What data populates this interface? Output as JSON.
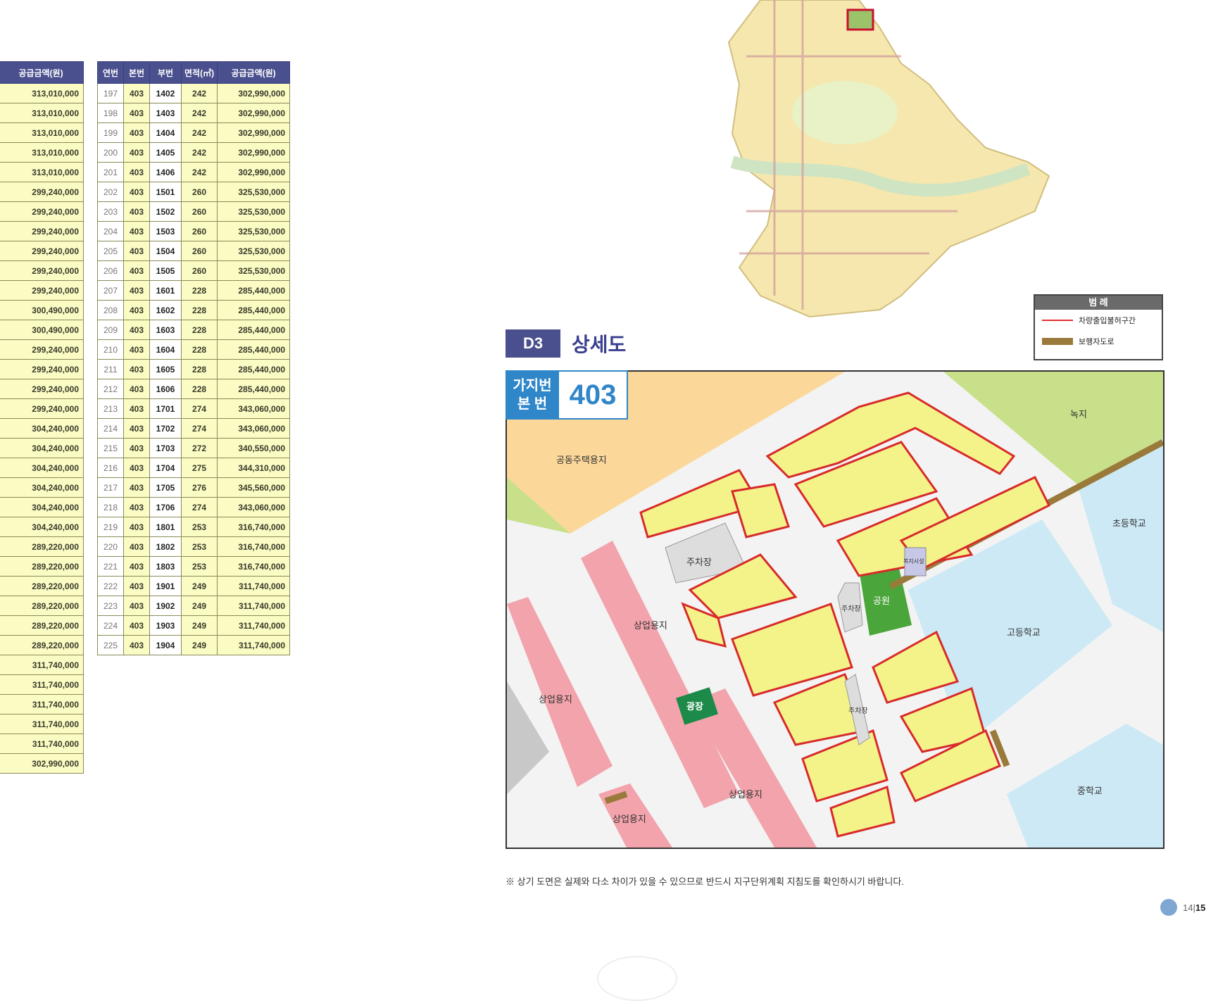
{
  "table_left": {
    "header": [
      "",
      "공급금액(원)"
    ],
    "rows": [
      "313,010,000",
      "313,010,000",
      "313,010,000",
      "313,010,000",
      "313,010,000",
      "299,240,000",
      "299,240,000",
      "299,240,000",
      "299,240,000",
      "299,240,000",
      "299,240,000",
      "300,490,000",
      "300,490,000",
      "299,240,000",
      "299,240,000",
      "299,240,000",
      "299,240,000",
      "304,240,000",
      "304,240,000",
      "304,240,000",
      "304,240,000",
      "304,240,000",
      "304,240,000",
      "289,220,000",
      "289,220,000",
      "289,220,000",
      "289,220,000",
      "289,220,000",
      "289,220,000",
      "311,740,000",
      "311,740,000",
      "311,740,000",
      "311,740,000",
      "311,740,000",
      "302,990,000"
    ]
  },
  "table_right": {
    "header": [
      "연번",
      "본번",
      "부번",
      "면적(㎡)",
      "공급금액(원)"
    ],
    "rows": [
      [
        "197",
        "403",
        "1402",
        "242",
        "302,990,000"
      ],
      [
        "198",
        "403",
        "1403",
        "242",
        "302,990,000"
      ],
      [
        "199",
        "403",
        "1404",
        "242",
        "302,990,000"
      ],
      [
        "200",
        "403",
        "1405",
        "242",
        "302,990,000"
      ],
      [
        "201",
        "403",
        "1406",
        "242",
        "302,990,000"
      ],
      [
        "202",
        "403",
        "1501",
        "260",
        "325,530,000"
      ],
      [
        "203",
        "403",
        "1502",
        "260",
        "325,530,000"
      ],
      [
        "204",
        "403",
        "1503",
        "260",
        "325,530,000"
      ],
      [
        "205",
        "403",
        "1504",
        "260",
        "325,530,000"
      ],
      [
        "206",
        "403",
        "1505",
        "260",
        "325,530,000"
      ],
      [
        "207",
        "403",
        "1601",
        "228",
        "285,440,000"
      ],
      [
        "208",
        "403",
        "1602",
        "228",
        "285,440,000"
      ],
      [
        "209",
        "403",
        "1603",
        "228",
        "285,440,000"
      ],
      [
        "210",
        "403",
        "1604",
        "228",
        "285,440,000"
      ],
      [
        "211",
        "403",
        "1605",
        "228",
        "285,440,000"
      ],
      [
        "212",
        "403",
        "1606",
        "228",
        "285,440,000"
      ],
      [
        "213",
        "403",
        "1701",
        "274",
        "343,060,000"
      ],
      [
        "214",
        "403",
        "1702",
        "274",
        "343,060,000"
      ],
      [
        "215",
        "403",
        "1703",
        "272",
        "340,550,000"
      ],
      [
        "216",
        "403",
        "1704",
        "275",
        "344,310,000"
      ],
      [
        "217",
        "403",
        "1705",
        "276",
        "345,560,000"
      ],
      [
        "218",
        "403",
        "1706",
        "274",
        "343,060,000"
      ],
      [
        "219",
        "403",
        "1801",
        "253",
        "316,740,000"
      ],
      [
        "220",
        "403",
        "1802",
        "253",
        "316,740,000"
      ],
      [
        "221",
        "403",
        "1803",
        "253",
        "316,740,000"
      ],
      [
        "222",
        "403",
        "1901",
        "249",
        "311,740,000"
      ],
      [
        "223",
        "403",
        "1902",
        "249",
        "311,740,000"
      ],
      [
        "224",
        "403",
        "1903",
        "249",
        "311,740,000"
      ],
      [
        "225",
        "403",
        "1904",
        "249",
        "311,740,000"
      ]
    ]
  },
  "section": {
    "code": "D3",
    "title": "상세도"
  },
  "legend": {
    "title": "범 례",
    "items": [
      {
        "label": "차량출입불허구간",
        "color": "#e03030"
      },
      {
        "label": "보행자도로",
        "color": "#9a7a3a"
      }
    ]
  },
  "badge": {
    "line1": "가지번",
    "line2": "본 번",
    "number": "403"
  },
  "map_labels": {
    "housing": "공동주택용지",
    "green": "녹지",
    "elementary": "초등학교",
    "high": "고등학교",
    "middle": "중학교",
    "park": "공원",
    "plaza": "광장",
    "parking1": "주차장",
    "parking2": "주차장",
    "parking3": "주차장",
    "commercial1": "상업용지",
    "commercial2": "상업용지",
    "commercial3": "상업용지",
    "commercial4": "상업용지",
    "welfare": "복지시설"
  },
  "note": "※ 상기 도면은 실제와 다소 차이가 있을 수 있으므로 반드시 지구단위계획 지침도를 확인하시기 바랍니다.",
  "pages": {
    "prev": "14",
    "current": "15"
  },
  "colors": {
    "header_blue": "#4a4f8e",
    "cell_yellow": "#fbfbc4",
    "badge_blue": "#2f86c9",
    "commercial_pink": "#f2a3ab",
    "school_blue": "#cde9f6",
    "green": "#c8e08a",
    "housing_orange": "#fbd89a",
    "parcel_yellow": "#f3f38a"
  }
}
